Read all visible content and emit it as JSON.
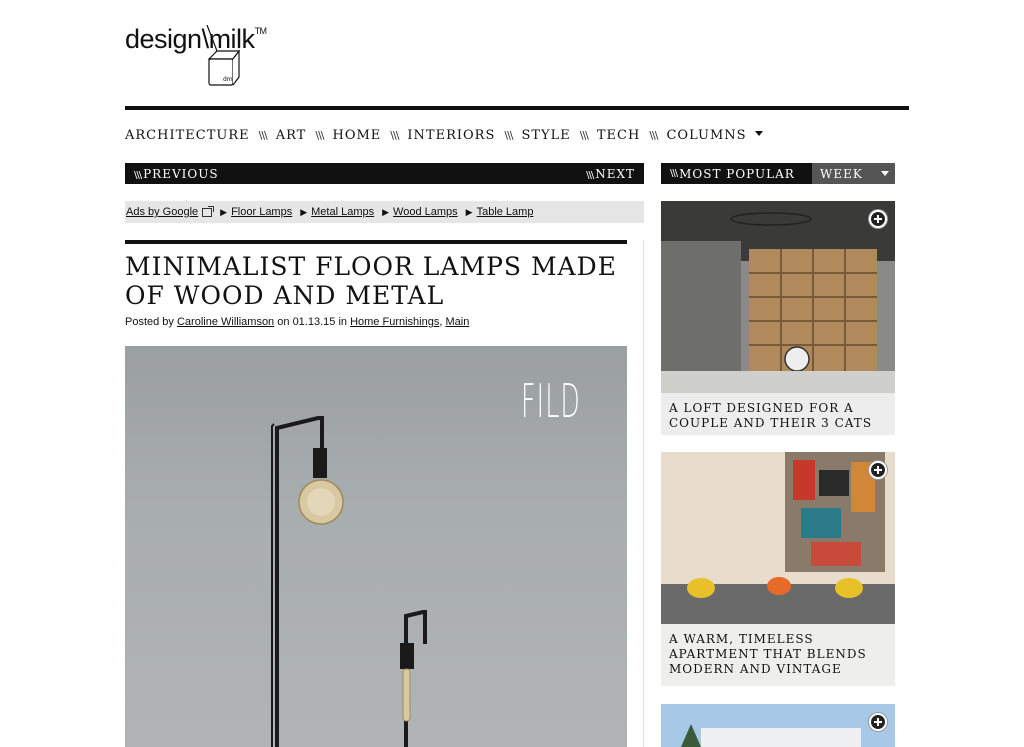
{
  "logo": {
    "text": "design\\milk",
    "tm": "TM",
    "carton_label": "dm"
  },
  "nav": {
    "items": [
      "ARCHITECTURE",
      "ART",
      "HOME",
      "INTERIORS",
      "STYLE",
      "TECH",
      "COLUMNS"
    ],
    "separator": "\\\\\\"
  },
  "pager": {
    "prev": "PREVIOUS",
    "next": "NEXT",
    "slashes": "\\\\\\"
  },
  "ads": {
    "label": "Ads by Google",
    "links": [
      "Floor Lamps",
      "Metal Lamps",
      "Wood Lamps",
      "Table Lamp"
    ]
  },
  "article": {
    "title": "MINIMALIST FLOOR LAMPS MADE OF WOOD AND METAL",
    "byline_prefix": "Posted by",
    "author": "Caroline Williamson",
    "on": "on",
    "date": "01.13.15",
    "in": "in",
    "category_1": "Home Furnishings",
    "comma": ",",
    "category_2": "Main",
    "image_brand": "FILD"
  },
  "sidebar": {
    "popular_label": "MOST POPULAR",
    "period": "WEEK",
    "cards": [
      {
        "caption": "A LOFT DESIGNED FOR A COUPLE AND THEIR 3 CATS"
      },
      {
        "caption": "A WARM, TIMELESS APARTMENT THAT BLENDS MODERN AND VINTAGE"
      },
      {
        "caption": ""
      }
    ]
  },
  "colors": {
    "accent": "#111111",
    "ads_bg": "#e6e6e6",
    "select_bg": "#555555"
  }
}
